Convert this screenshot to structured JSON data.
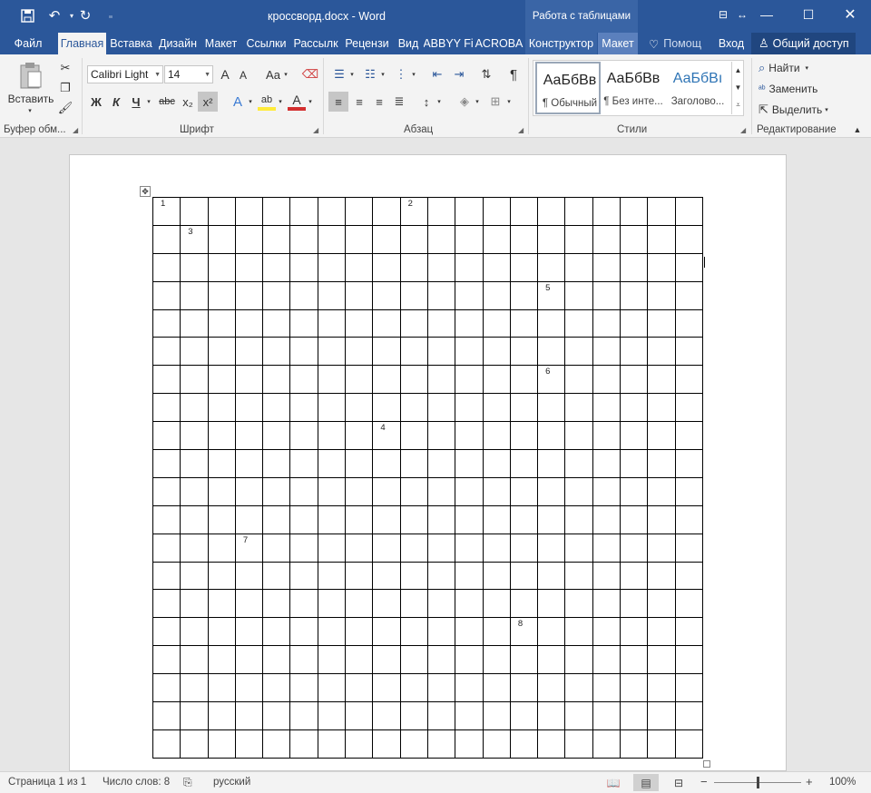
{
  "titlebar": {
    "doc_title": "кроссворд.docx - Word",
    "context_title": "Работа с таблицами",
    "save_icon": "save-icon",
    "undo_icon": "undo-icon",
    "redo_icon": "redo-icon"
  },
  "tabs": {
    "file": "Файл",
    "home": "Главная",
    "insert": "Вставка",
    "design": "Дизайн",
    "layout": "Макет",
    "references": "Ссылки",
    "mailings": "Рассылк",
    "review": "Рецензи",
    "view": "Вид",
    "abbyy": "ABBYY Fi",
    "acrobat": "ACROBA",
    "table_design": "Конструктор",
    "table_layout": "Макет",
    "tell_me": "Помощ",
    "signin": "Вход",
    "share": "Общий доступ"
  },
  "ribbon": {
    "clipboard": {
      "paste_label": "Вставить",
      "group_label": "Буфер обм..."
    },
    "font": {
      "font_name": "Calibri Light",
      "font_size": "14",
      "group_label": "Шрифт",
      "bold": "Ж",
      "italic": "К",
      "underline": "Ч",
      "strike": "abc",
      "subscript": "x₂",
      "superscript": "x²",
      "case": "Aa",
      "grow": "A",
      "shrink": "A",
      "text_effects": "A",
      "font_color": "A"
    },
    "paragraph": {
      "group_label": "Абзац",
      "pilcrow": "¶"
    },
    "styles": {
      "group_label": "Стили",
      "items": [
        {
          "sample": "АаБбВв",
          "name": "¶ Обычный"
        },
        {
          "sample": "АаБбВв",
          "name": "¶ Без инте..."
        },
        {
          "sample": "АаБбВı",
          "name": "Заголово..."
        }
      ]
    },
    "editing": {
      "group_label": "Редактирование",
      "find": "Найти",
      "replace": "Заменить",
      "select": "Выделить"
    }
  },
  "crossword": {
    "rows": 20,
    "cols": 20,
    "numbers": [
      {
        "row": 0,
        "col": 0,
        "n": "1"
      },
      {
        "row": 0,
        "col": 9,
        "n": "2"
      },
      {
        "row": 1,
        "col": 1,
        "n": "3"
      },
      {
        "row": 3,
        "col": 14,
        "n": "5"
      },
      {
        "row": 6,
        "col": 14,
        "n": "6"
      },
      {
        "row": 8,
        "col": 8,
        "n": "4"
      },
      {
        "row": 12,
        "col": 3,
        "n": "7"
      },
      {
        "row": 15,
        "col": 13,
        "n": "8"
      }
    ]
  },
  "statusbar": {
    "page": "Страница 1 из 1",
    "words": "Число слов: 8",
    "language": "русский",
    "zoom": "100%",
    "zoom_value": 100
  }
}
